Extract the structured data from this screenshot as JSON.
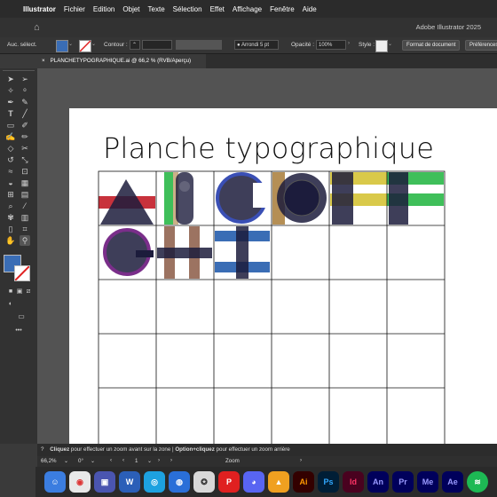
{
  "menubar": {
    "app": "Illustrator",
    "items": [
      "Fichier",
      "Edition",
      "Objet",
      "Texte",
      "Sélection",
      "Effet",
      "Affichage",
      "Fenêtre",
      "Aide"
    ]
  },
  "titlebar": {
    "window_title": "Adobe Illustrator 2025"
  },
  "controlbar": {
    "selection_label": "Auc. sélect.",
    "stroke_label": "Contour :",
    "brush_label": "Arrondi 5 pt",
    "opacity_label": "Opacité :",
    "opacity_value": "100%",
    "style_label": "Style :",
    "doc_format_button": "Format de document",
    "preferences_button": "Préférences",
    "fill_color": "#3a6db5"
  },
  "tab": {
    "close": "×",
    "label": "PLANCHETYPOGRAPHIQUE.ai @ 66,2 % (RVB/Aperçu)"
  },
  "canvas": {
    "heading": "Planche typographique"
  },
  "status": {
    "hint_bold1": "Cliquez",
    "hint_text1": " pour effectuer un zoom avant sur la zone  |  ",
    "hint_bold2": "Option+cliquez",
    "hint_text2": " pour effectuer un zoom arrière",
    "zoom_value": "66,2%",
    "rotation_value": "0°",
    "artboard_number": "1",
    "tool_name": "Zoom"
  },
  "toolbar": {
    "icons": [
      "selection-tool-icon",
      "direct-selection-tool-icon",
      "magic-wand-icon",
      "lasso-icon",
      "pen-tool-icon",
      "curvature-icon",
      "type-tool-icon",
      "line-tool-icon",
      "rectangle-tool-icon",
      "paintbrush-icon",
      "shaper-icon",
      "pencil-icon",
      "eraser-icon",
      "scissors-icon",
      "rotate-icon",
      "scale-icon",
      "width-tool-icon",
      "free-transform-icon",
      "shape-builder-icon",
      "perspective-icon",
      "mesh-icon",
      "gradient-icon",
      "eyedropper-icon",
      "blend-icon",
      "symbol-sprayer-icon",
      "graph-icon",
      "artboard-tool-icon",
      "slice-icon",
      "hand-tool-icon",
      "zoom-tool-icon"
    ],
    "more": "•••"
  },
  "dock": {
    "apps": [
      "Ai",
      "Ps",
      "Id",
      "An",
      "Pr",
      "Me",
      "Ae"
    ]
  },
  "colors": {
    "red": "#c8323c",
    "green": "#3fbf5a",
    "navy": "#1c1c3c",
    "gold": "#d9c94a",
    "purple": "#7a2e8a",
    "brown": "#8b5a45",
    "blue": "#3a6db5",
    "tan": "#b58f55"
  }
}
